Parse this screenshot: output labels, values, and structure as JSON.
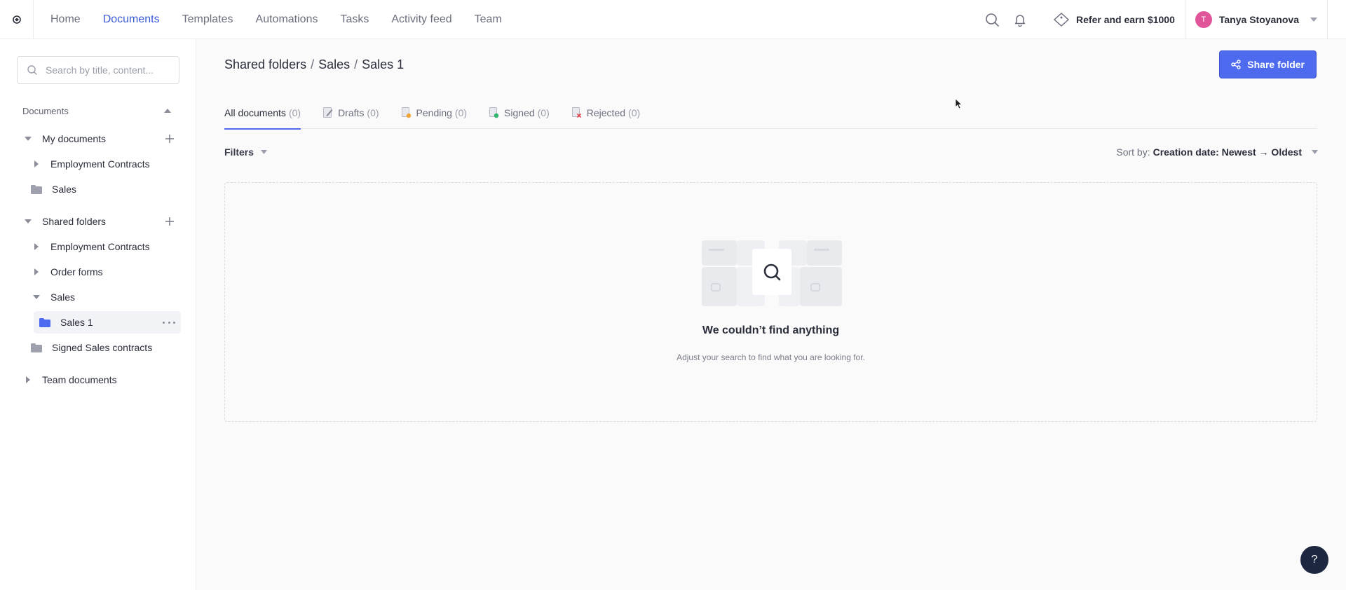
{
  "nav": {
    "items": [
      {
        "label": "Home"
      },
      {
        "label": "Documents"
      },
      {
        "label": "Templates"
      },
      {
        "label": "Automations"
      },
      {
        "label": "Tasks"
      },
      {
        "label": "Activity feed"
      },
      {
        "label": "Team"
      }
    ],
    "active": "Documents",
    "refer_label": "Refer and earn $1000",
    "user": {
      "initial": "T",
      "name": "Tanya Stoyanova",
      "avatar_color": "#e0559a"
    }
  },
  "sidebar": {
    "search_placeholder": "Search by title, content...",
    "section_label": "Documents",
    "my_documents": {
      "label": "My documents",
      "children": [
        {
          "label": "Employment Contracts"
        },
        {
          "label": "Sales"
        }
      ]
    },
    "shared_folders": {
      "label": "Shared folders",
      "children": [
        {
          "label": "Employment Contracts"
        },
        {
          "label": "Order forms"
        },
        {
          "label": "Sales"
        },
        {
          "label": "Sales 1"
        },
        {
          "label": "Signed Sales contracts"
        }
      ]
    },
    "team_documents": {
      "label": "Team documents"
    }
  },
  "main": {
    "breadcrumb": [
      {
        "label": "Shared folders"
      },
      {
        "label": "Sales"
      },
      {
        "label": "Sales 1"
      }
    ],
    "breadcrumb_sep": "/",
    "share_button": "Share folder",
    "tabs": [
      {
        "label": "All documents",
        "count": "(0)"
      },
      {
        "label": "Drafts",
        "count": "(0)"
      },
      {
        "label": "Pending",
        "count": "(0)"
      },
      {
        "label": "Signed",
        "count": "(0)"
      },
      {
        "label": "Rejected",
        "count": "(0)"
      }
    ],
    "filters_label": "Filters",
    "sort_label": "Sort by:",
    "sort_value": "Creation date: Newest → Oldest",
    "empty_title": "We couldn’t find anything",
    "empty_subtitle": "Adjust your search to find what you are looking for."
  },
  "help_label": "?",
  "colors": {
    "accent": "#4e6bf0",
    "nav_active": "#3b5bd9",
    "folder_selected": "#4e6bf0",
    "folder_default": "#9ea1ad"
  }
}
